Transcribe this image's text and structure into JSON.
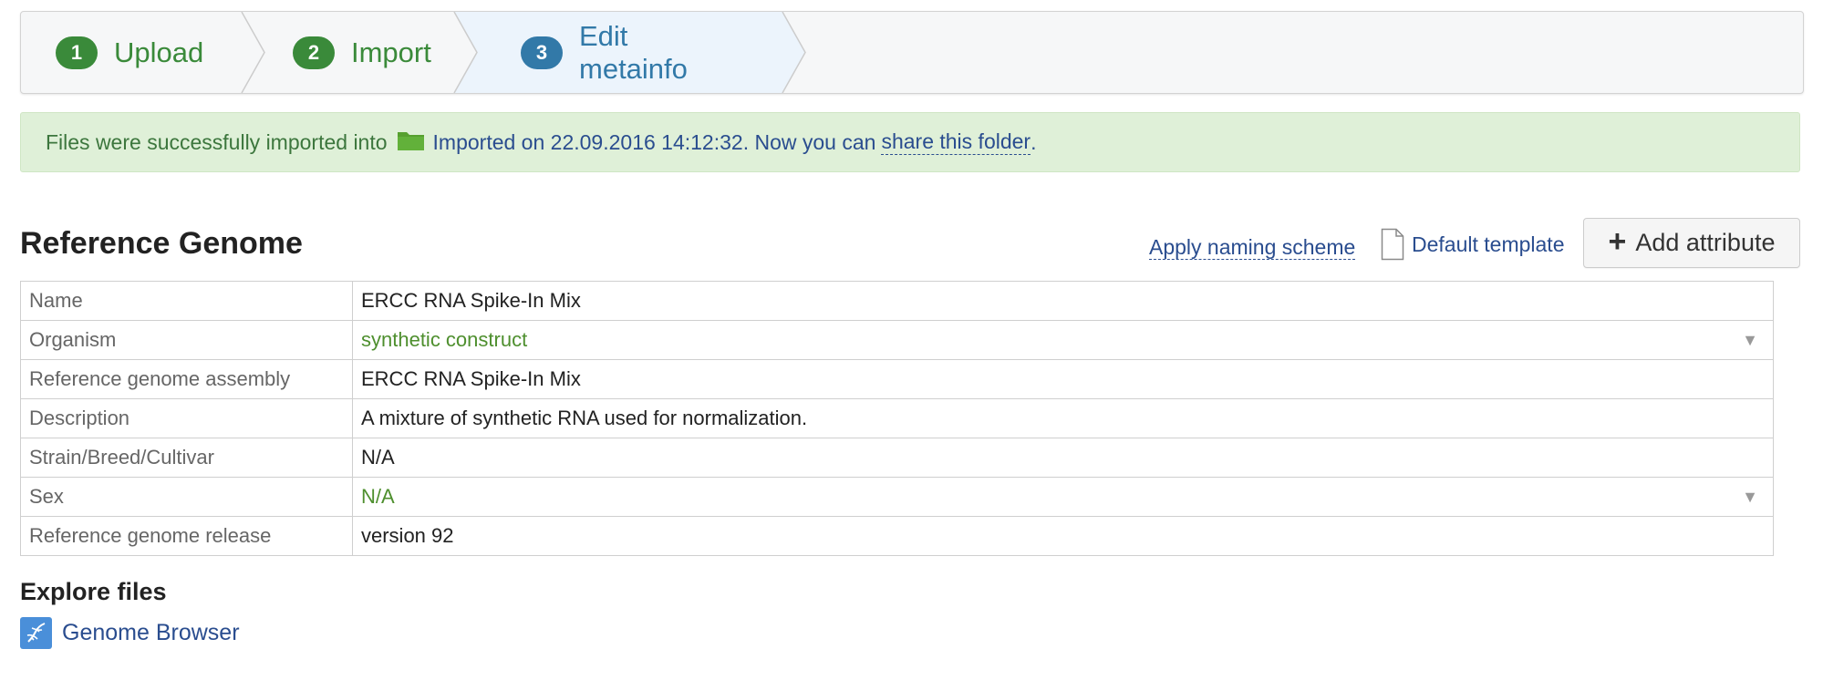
{
  "wizard": {
    "steps": [
      {
        "number": "1",
        "label": "Upload",
        "state": "done"
      },
      {
        "number": "2",
        "label": "Import",
        "state": "done"
      },
      {
        "number": "3",
        "label": "Edit metainfo",
        "state": "active"
      }
    ]
  },
  "alert": {
    "prefix": "Files were successfully imported into",
    "folder_icon": "folder-icon",
    "folder_name": "Imported on 22.09.2016 14:12:32",
    "middle": ". Now you can",
    "share_link": "share this folder",
    "suffix": "."
  },
  "section": {
    "title": "Reference Genome",
    "naming_link": "Apply naming scheme",
    "template_icon": "document-icon",
    "template_link": "Default template",
    "add_button": "Add attribute",
    "add_button_icon": "plus-icon"
  },
  "attributes": [
    {
      "key": "Name",
      "value": "ERCC RNA Spike-In Mix",
      "type": "text"
    },
    {
      "key": "Organism",
      "value": "synthetic construct",
      "type": "select"
    },
    {
      "key": "Reference genome assembly",
      "value": "ERCC RNA Spike-In Mix",
      "type": "text"
    },
    {
      "key": "Description",
      "value": "A mixture of synthetic RNA used for normalization.",
      "type": "text"
    },
    {
      "key": "Strain/Breed/Cultivar",
      "value": "N/A",
      "type": "text"
    },
    {
      "key": "Sex",
      "value": "N/A",
      "type": "select"
    },
    {
      "key": "Reference genome release",
      "value": "version 92",
      "type": "text"
    }
  ],
  "explore": {
    "title": "Explore files",
    "browser_icon": "dna-icon",
    "browser_link": "Genome Browser"
  },
  "colors": {
    "done": "#3a8a3a",
    "active": "#3279a8",
    "alert_bg": "#dff0d8",
    "link": "#2a4d8f",
    "select_value": "#4e8f2e"
  }
}
